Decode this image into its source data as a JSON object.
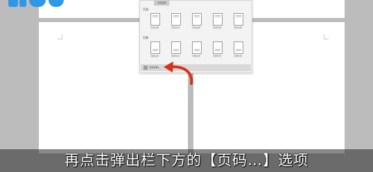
{
  "colors": {
    "accent_arrow": "#d8321e",
    "logo": "#2f97e8",
    "subtitle_bg": "rgba(40,40,40,0.55)"
  },
  "popup": {
    "tab_label": "页眉页脚",
    "header_section_label": "页眉",
    "footer_section_label": "页脚",
    "header_thumbs": [
      "页眉左侧",
      "页眉中间",
      "页眉右侧",
      "页眉外侧",
      "页眉内侧"
    ],
    "footer_thumbs": [
      "页脚左侧",
      "页脚中间",
      "页脚右侧",
      "页脚外侧",
      "页脚内侧"
    ],
    "more_option_label": "页码(N)...",
    "more_option_icon": "page-number-icon"
  },
  "annotation": {
    "arrow_icon": "curved-arrow-icon"
  },
  "subtitle": {
    "text": "再点击弹出栏下方的【页码…】选项"
  }
}
